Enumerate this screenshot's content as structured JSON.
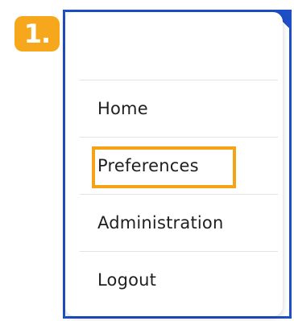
{
  "step_badge": {
    "label": "1."
  },
  "menu": {
    "items": [
      {
        "label": "Home"
      },
      {
        "label": "Preferences",
        "highlighted": true
      },
      {
        "label": "Administration"
      },
      {
        "label": "Logout"
      }
    ]
  },
  "colors": {
    "frame": "#1e4fc6",
    "badge": "#f7a71b",
    "highlight": "#f5a314",
    "text": "#1f1f1f",
    "divider": "#e3e3e3"
  }
}
